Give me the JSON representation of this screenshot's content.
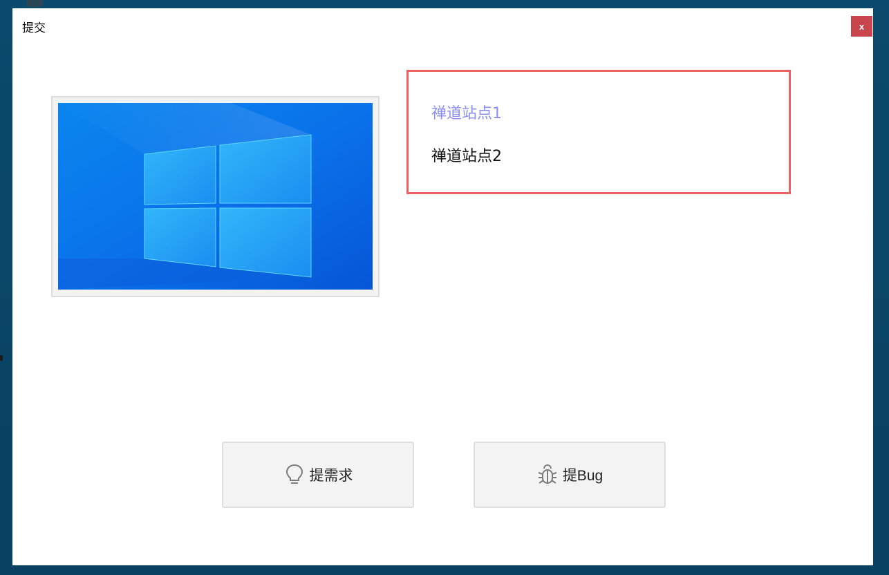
{
  "window": {
    "title": "提交",
    "close_label": "x"
  },
  "sites": [
    {
      "label": "禅道站点1",
      "selected": true
    },
    {
      "label": "禅道站点2",
      "selected": false
    }
  ],
  "actions": {
    "story_label": "提需求",
    "bug_label": "提Bug"
  },
  "icons": {
    "story": "lightbulb-icon",
    "bug": "bug-icon",
    "close": "close-icon"
  },
  "colors": {
    "close_button": "#c9454d",
    "site_list_border": "#ec6264",
    "selected_site_text": "#8b8ef3",
    "wallpaper_blue": "#0a78f0"
  }
}
